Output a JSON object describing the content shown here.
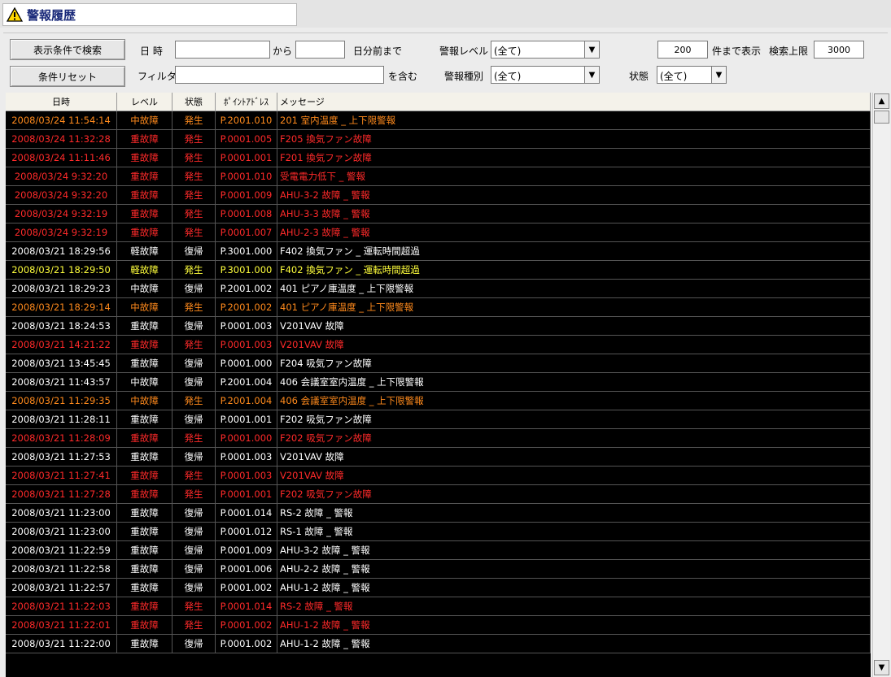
{
  "title": "警報履歴",
  "colors": {
    "orange": "#ff8a1c",
    "red": "#ff2a2a",
    "white": "#ffffff",
    "yellow": "#ffff3c"
  },
  "filter": {
    "search_button": "表示条件で検索",
    "reset_button": "条件リセット",
    "datetime_label": "日 時",
    "datetime_value": "",
    "from_label": "から",
    "days_value": "",
    "days_label": "日分前まで",
    "level_label": "警報レベル",
    "level_value": "(全て)",
    "show_count_value": "200",
    "show_count_label": "件まで表示",
    "limit_label": "検索上限",
    "limit_value": "3000",
    "filter_label": "フィルタ",
    "filter_value": "",
    "contains_label": "を含む",
    "type_label": "警報種別",
    "type_value": "(全て)",
    "state_label": "状態",
    "state_value": "(全て)"
  },
  "table": {
    "headers": [
      "日時",
      "レベル",
      "状態",
      "ﾎﾟｲﾝﾄｱﾄﾞﾚｽ",
      "メッセージ"
    ],
    "rows": [
      {
        "c": "orange",
        "d": [
          "2008/03/24 11:54:14",
          "中故障",
          "発生",
          "P.2001.010",
          "201 室内温度 _ 上下限警報"
        ]
      },
      {
        "c": "red",
        "d": [
          "2008/03/24 11:32:28",
          "重故障",
          "発生",
          "P.0001.005",
          "F205 換気ファン故障"
        ]
      },
      {
        "c": "red",
        "d": [
          "2008/03/24 11:11:46",
          "重故障",
          "発生",
          "P.0001.001",
          "F201 換気ファン故障"
        ]
      },
      {
        "c": "red",
        "d": [
          "2008/03/24 9:32:20",
          "重故障",
          "発生",
          "P.0001.010",
          "受電電力低下 _ 警報"
        ]
      },
      {
        "c": "red",
        "d": [
          "2008/03/24 9:32:20",
          "重故障",
          "発生",
          "P.0001.009",
          "AHU-3-2 故障 _ 警報"
        ]
      },
      {
        "c": "red",
        "d": [
          "2008/03/24 9:32:19",
          "重故障",
          "発生",
          "P.0001.008",
          "AHU-3-3 故障 _ 警報"
        ]
      },
      {
        "c": "red",
        "d": [
          "2008/03/24 9:32:19",
          "重故障",
          "発生",
          "P.0001.007",
          "AHU-2-3 故障 _ 警報"
        ]
      },
      {
        "c": "white",
        "d": [
          "2008/03/21 18:29:56",
          "軽故障",
          "復帰",
          "P.3001.000",
          "F402 換気ファン _ 運転時間超過"
        ]
      },
      {
        "c": "yellow",
        "d": [
          "2008/03/21 18:29:50",
          "軽故障",
          "発生",
          "P.3001.000",
          "F402 換気ファン _ 運転時間超過"
        ]
      },
      {
        "c": "white",
        "d": [
          "2008/03/21 18:29:23",
          "中故障",
          "復帰",
          "P.2001.002",
          "401 ピアノ庫温度 _ 上下限警報"
        ]
      },
      {
        "c": "orange",
        "d": [
          "2008/03/21 18:29:14",
          "中故障",
          "発生",
          "P.2001.002",
          "401 ピアノ庫温度 _ 上下限警報"
        ]
      },
      {
        "c": "white",
        "d": [
          "2008/03/21 18:24:53",
          "重故障",
          "復帰",
          "P.0001.003",
          "V201VAV 故障"
        ]
      },
      {
        "c": "red",
        "d": [
          "2008/03/21 14:21:22",
          "重故障",
          "発生",
          "P.0001.003",
          "V201VAV 故障"
        ]
      },
      {
        "c": "white",
        "d": [
          "2008/03/21 13:45:45",
          "重故障",
          "復帰",
          "P.0001.000",
          "F204 吸気ファン故障"
        ]
      },
      {
        "c": "white",
        "d": [
          "2008/03/21 11:43:57",
          "中故障",
          "復帰",
          "P.2001.004",
          "406 会議室室内温度 _ 上下限警報"
        ]
      },
      {
        "c": "orange",
        "d": [
          "2008/03/21 11:29:35",
          "中故障",
          "発生",
          "P.2001.004",
          "406 会議室室内温度 _ 上下限警報"
        ]
      },
      {
        "c": "white",
        "d": [
          "2008/03/21 11:28:11",
          "重故障",
          "復帰",
          "P.0001.001",
          "F202 吸気ファン故障"
        ]
      },
      {
        "c": "red",
        "d": [
          "2008/03/21 11:28:09",
          "重故障",
          "発生",
          "P.0001.000",
          "F202 吸気ファン故障"
        ]
      },
      {
        "c": "white",
        "d": [
          "2008/03/21 11:27:53",
          "重故障",
          "復帰",
          "P.0001.003",
          "V201VAV 故障"
        ]
      },
      {
        "c": "red",
        "d": [
          "2008/03/21 11:27:41",
          "重故障",
          "発生",
          "P.0001.003",
          "V201VAV 故障"
        ]
      },
      {
        "c": "red",
        "d": [
          "2008/03/21 11:27:28",
          "重故障",
          "発生",
          "P.0001.001",
          "F202 吸気ファン故障"
        ]
      },
      {
        "c": "white",
        "d": [
          "2008/03/21 11:23:00",
          "重故障",
          "復帰",
          "P.0001.014",
          "RS-2 故障 _ 警報"
        ]
      },
      {
        "c": "white",
        "d": [
          "2008/03/21 11:23:00",
          "重故障",
          "復帰",
          "P.0001.012",
          "RS-1 故障 _ 警報"
        ]
      },
      {
        "c": "white",
        "d": [
          "2008/03/21 11:22:59",
          "重故障",
          "復帰",
          "P.0001.009",
          "AHU-3-2 故障 _ 警報"
        ]
      },
      {
        "c": "white",
        "d": [
          "2008/03/21 11:22:58",
          "重故障",
          "復帰",
          "P.0001.006",
          "AHU-2-2 故障 _ 警報"
        ]
      },
      {
        "c": "white",
        "d": [
          "2008/03/21 11:22:57",
          "重故障",
          "復帰",
          "P.0001.002",
          "AHU-1-2 故障 _ 警報"
        ]
      },
      {
        "c": "red",
        "d": [
          "2008/03/21 11:22:03",
          "重故障",
          "発生",
          "P.0001.014",
          "RS-2 故障 _ 警報"
        ]
      },
      {
        "c": "red",
        "d": [
          "2008/03/21 11:22:01",
          "重故障",
          "発生",
          "P.0001.002",
          "AHU-1-2 故障 _ 警報"
        ]
      },
      {
        "c": "white",
        "d": [
          "2008/03/21 11:22:00",
          "重故障",
          "復帰",
          "P.0001.002",
          "AHU-1-2 故障 _ 警報"
        ]
      }
    ]
  }
}
